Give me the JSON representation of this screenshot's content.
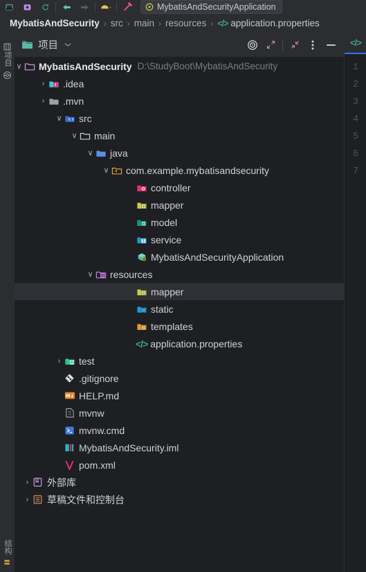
{
  "toolbar": {
    "buttons": [
      {
        "name": "project-widget-icon",
        "label": ""
      },
      {
        "name": "ai-assistant-icon",
        "label": ""
      },
      {
        "name": "vcs-update-icon",
        "label": ""
      },
      {
        "name": "back-arrow-icon",
        "label": ""
      },
      {
        "name": "forward-arrow-icon",
        "label": ""
      },
      {
        "name": "build-icon",
        "label": ""
      },
      {
        "name": "search-everywhere-icon",
        "label": ""
      }
    ],
    "run_config": {
      "label": "MybatisAndSecurityApplication",
      "icon": "spring-boot-run-icon"
    }
  },
  "breadcrumb": {
    "items": [
      {
        "label": "MybatisAndSecurity",
        "style": "first"
      },
      {
        "label": "src",
        "style": "mid"
      },
      {
        "label": "main",
        "style": "mid"
      },
      {
        "label": "resources",
        "style": "mid"
      },
      {
        "label": "application.properties",
        "style": "last",
        "icon": "properties-file-icon"
      }
    ],
    "separator": "›"
  },
  "left_strip": {
    "project_label": "项目",
    "project_icon": "project-tool-window-icon",
    "commit_icon": "commit-icon",
    "structure_label": "结构",
    "structure_icon": "structure-tool-window-icon"
  },
  "panel_header": {
    "title": "项目",
    "folder_icon": "project-folder-icon",
    "chevron": "⌄",
    "buttons": [
      {
        "name": "select-opened-file-button",
        "icon": "target-icon"
      },
      {
        "name": "expand-all-button",
        "icon": "expand-arrows-icon"
      },
      {
        "name": "collapse-all-button",
        "icon": "collapse-arrows-icon"
      },
      {
        "name": "options-button",
        "icon": "more-vertical-icon"
      },
      {
        "name": "hide-button",
        "icon": "minus-icon"
      }
    ]
  },
  "tree": {
    "rows": [
      {
        "indent": 0,
        "arrow": "down",
        "icon": "project-root-folder-icon",
        "label": "MybatisAndSecurity",
        "bold": true,
        "sub": "D:\\StudyBoot\\MybatisAndSecurity",
        "selected": false
      },
      {
        "indent": 1,
        "arrow": "right",
        "icon": "idea-folder-icon",
        "label": ".idea",
        "bold": false,
        "sub": "",
        "selected": false
      },
      {
        "indent": 1,
        "arrow": "right",
        "icon": "plain-folder-icon",
        "label": ".mvn",
        "bold": false,
        "sub": "",
        "selected": false
      },
      {
        "indent": 1,
        "arrow": "down",
        "icon": "source-root-folder-icon",
        "label": "src",
        "bold": false,
        "sub": "",
        "selected": false
      },
      {
        "indent": 2,
        "arrow": "down",
        "icon": "outline-folder-icon",
        "label": "main",
        "bold": false,
        "sub": "",
        "selected": false
      },
      {
        "indent": 3,
        "arrow": "down",
        "icon": "java-source-folder-icon",
        "label": "java",
        "bold": false,
        "sub": "",
        "selected": false
      },
      {
        "indent": 4,
        "arrow": "down",
        "icon": "package-folder-icon",
        "label": "com.example.mybatisandsecurity",
        "bold": false,
        "sub": "",
        "selected": false
      },
      {
        "indent": 5,
        "arrow": "none",
        "icon": "controller-package-icon",
        "label": "controller",
        "bold": false,
        "sub": "",
        "selected": false
      },
      {
        "indent": 5,
        "arrow": "none",
        "icon": "mapper-package-icon",
        "label": "mapper",
        "bold": false,
        "sub": "",
        "selected": false
      },
      {
        "indent": 5,
        "arrow": "none",
        "icon": "model-package-icon",
        "label": "model",
        "bold": false,
        "sub": "",
        "selected": false
      },
      {
        "indent": 5,
        "arrow": "none",
        "icon": "service-package-icon",
        "label": "service",
        "bold": false,
        "sub": "",
        "selected": false
      },
      {
        "indent": 5,
        "arrow": "none",
        "icon": "spring-boot-class-icon",
        "label": "MybatisAndSecurityApplication",
        "bold": false,
        "sub": "",
        "selected": false
      },
      {
        "indent": 3,
        "arrow": "down",
        "icon": "resources-folder-icon",
        "label": "resources",
        "bold": false,
        "sub": "",
        "selected": false
      },
      {
        "indent": 5,
        "arrow": "none",
        "icon": "mapper-package-icon",
        "label": "mapper",
        "bold": false,
        "sub": "",
        "selected": true
      },
      {
        "indent": 5,
        "arrow": "none",
        "icon": "static-folder-icon",
        "label": "static",
        "bold": false,
        "sub": "",
        "selected": false
      },
      {
        "indent": 5,
        "arrow": "none",
        "icon": "templates-folder-icon",
        "label": "templates",
        "bold": false,
        "sub": "",
        "selected": false
      },
      {
        "indent": 5,
        "arrow": "none",
        "icon": "properties-file-icon",
        "label": "application.properties",
        "bold": false,
        "sub": "",
        "selected": false
      },
      {
        "indent": 2,
        "arrow": "right",
        "icon": "test-source-folder-icon",
        "label": "test",
        "bold": false,
        "sub": "",
        "selected": false
      },
      {
        "indent": 2,
        "arrow": "none",
        "icon": "gitignore-file-icon",
        "label": ".gitignore",
        "bold": false,
        "sub": "",
        "selected": false
      },
      {
        "indent": 2,
        "arrow": "none",
        "icon": "markdown-file-icon",
        "label": "HELP.md",
        "bold": false,
        "sub": "",
        "selected": false
      },
      {
        "indent": 2,
        "arrow": "none",
        "icon": "binary-file-icon",
        "label": "mvnw",
        "bold": false,
        "sub": "",
        "selected": false
      },
      {
        "indent": 2,
        "arrow": "none",
        "icon": "cmd-file-icon",
        "label": "mvnw.cmd",
        "bold": false,
        "sub": "",
        "selected": false
      },
      {
        "indent": 2,
        "arrow": "none",
        "icon": "iml-module-file-icon",
        "label": "MybatisAndSecurity.iml",
        "bold": false,
        "sub": "",
        "selected": false
      },
      {
        "indent": 2,
        "arrow": "none",
        "icon": "maven-pom-file-icon",
        "label": "pom.xml",
        "bold": false,
        "sub": "",
        "selected": false
      },
      {
        "indent": 0,
        "arrow": "right",
        "icon": "external-libraries-icon",
        "label": "外部库",
        "bold": false,
        "sub": "",
        "selected": false
      },
      {
        "indent": 0,
        "arrow": "right",
        "icon": "scratches-consoles-icon",
        "label": "草稿文件和控制台",
        "bold": false,
        "sub": "",
        "selected": false
      }
    ]
  },
  "editor": {
    "tab_icon": "properties-file-icon",
    "line_numbers": [
      "1",
      "2",
      "3",
      "4",
      "5",
      "6",
      "7"
    ]
  },
  "colors": {
    "background": "#1e1f22",
    "chrome": "#2b2d30",
    "selection": "#2e3035",
    "accent": "#3574f0",
    "properties_green": "#3d9f86",
    "text": "#cfd2d6",
    "muted": "#797e85"
  }
}
